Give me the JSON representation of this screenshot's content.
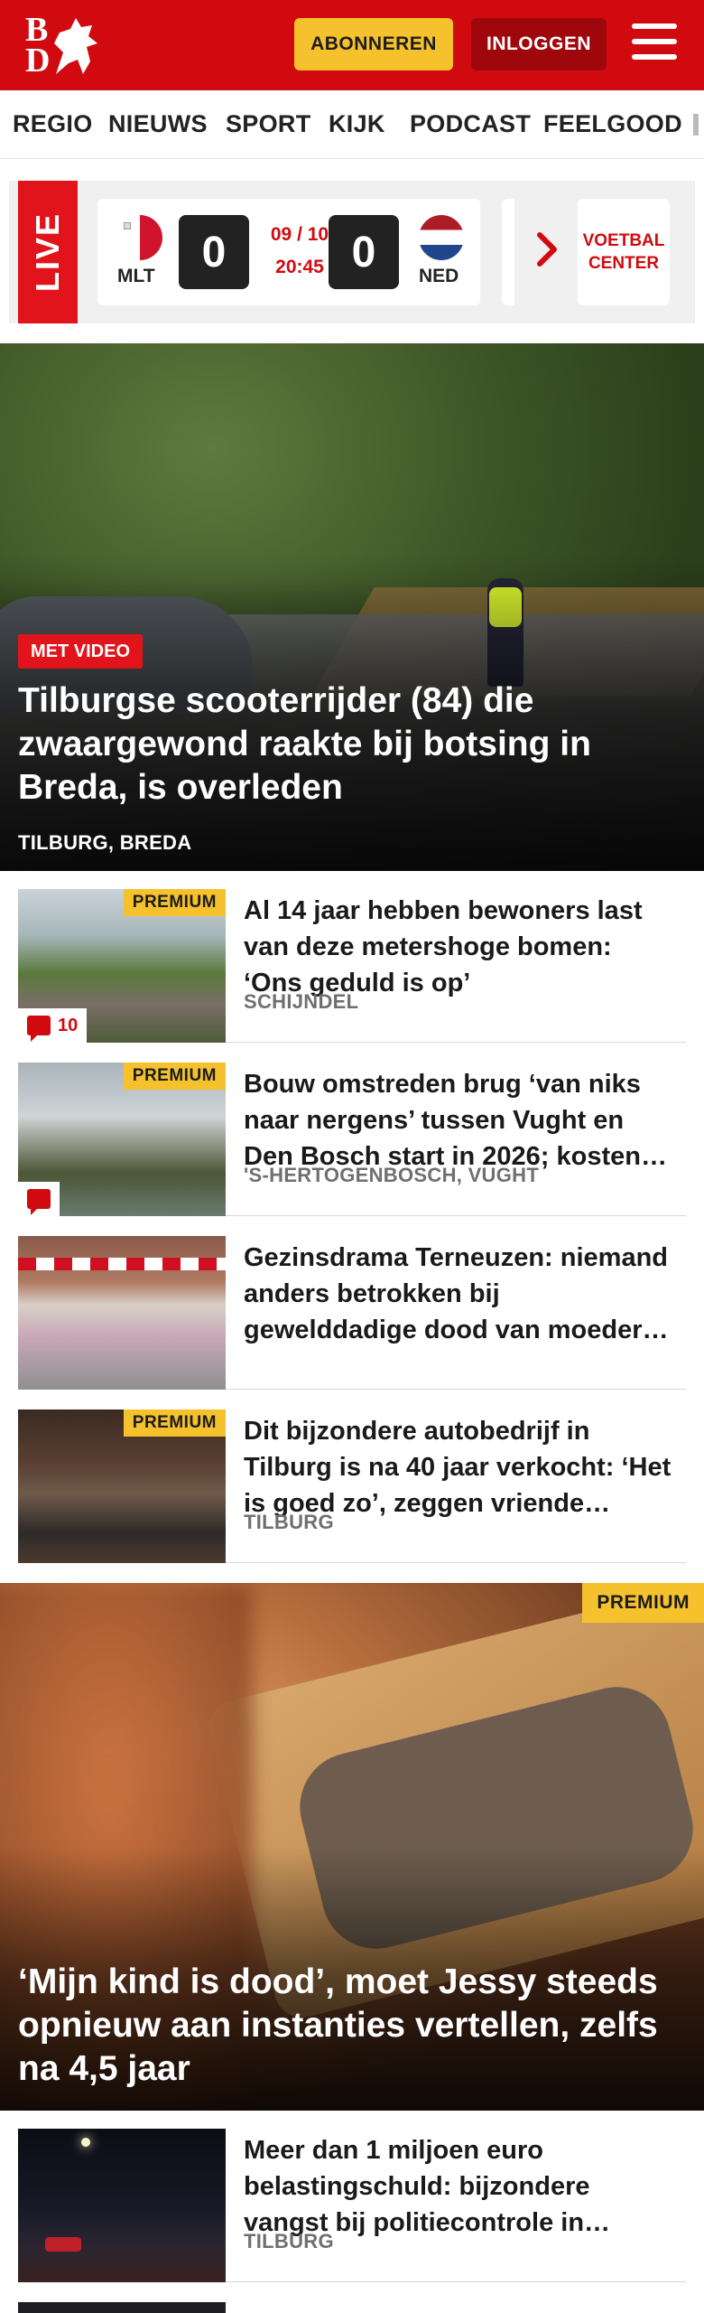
{
  "header": {
    "logo_b": "B",
    "logo_d": "D",
    "subscribe_label": "ABONNEREN",
    "login_label": "INLOGGEN",
    "menu_icon": "hamburger-icon",
    "brand_color": "#d10a10",
    "subscribe_color": "#f5c22d"
  },
  "nav": {
    "items": [
      {
        "label": "REGIO"
      },
      {
        "label": "NIEUWS"
      },
      {
        "label": "SPORT"
      },
      {
        "label": "KIJK"
      },
      {
        "label": "PODCAST"
      },
      {
        "label": "FEELGOOD"
      }
    ]
  },
  "live": {
    "label": "LIVE",
    "home_team": "MLT",
    "home_score": "0",
    "away_team": "NED",
    "away_score": "0",
    "date": "09 / 10",
    "time": "20:45",
    "center_label_1": "VOETBAL",
    "center_label_2": "CENTER"
  },
  "hero": {
    "badge": "MET VIDEO",
    "title": "Tilburgse scooterrijder (84) die zwaargewond raakte bij botsing in Breda, is overleden",
    "location": "TILBURG, BREDA"
  },
  "articles": [
    {
      "premium": "PREMIUM",
      "comments": "10",
      "title": "Al 14 jaar hebben bewoners last van deze metershoge bomen: ‘Ons geduld is op’",
      "location": "SCHIJNDEL"
    },
    {
      "premium": "PREMIUM",
      "title": "Bouw omstreden brug ‘van niks naar nergens’ tussen Vught en Den Bosch start in 2026; kosten…",
      "location": "'S-HERTOGENBOSCH, VUGHT"
    },
    {
      "title": "Gezinsdrama Terneuzen: niemand anders betrokken bij gewelddadige dood van moeder…"
    },
    {
      "premium": "PREMIUM",
      "title": "Dit bijzondere autobedrijf in Tilburg is na 40 jaar verkocht: ‘Het is goed zo’, zeggen vriende…",
      "location": "TILBURG"
    }
  ],
  "feature": {
    "premium": "PREMIUM",
    "title": "‘Mijn kind is dood’, moet Jessy steeds opnieuw aan instanties vertellen, zelfs na 4,5 jaar"
  },
  "articles2": [
    {
      "title": "Meer dan 1 miljoen euro belastingschuld: bijzondere vangst bij politiecontrole in…",
      "location": "TILBURG"
    }
  ]
}
